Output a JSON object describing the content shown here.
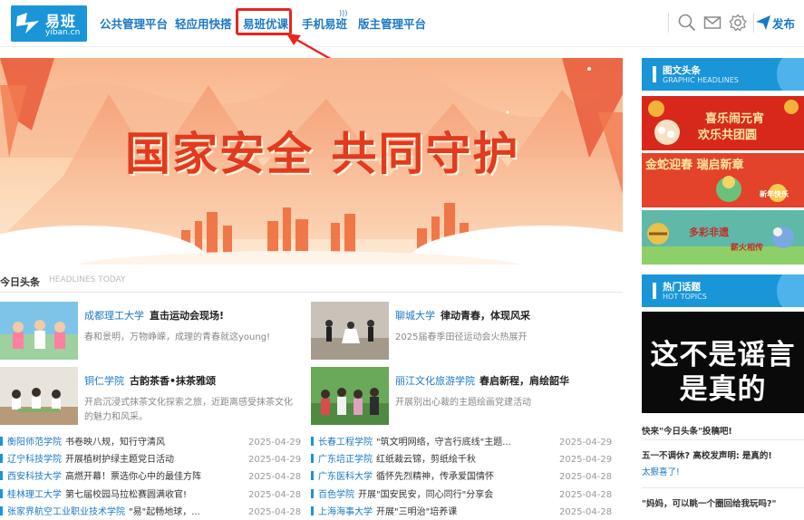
{
  "header": {
    "logo_name": "易班",
    "logo_url": "yiban.cn",
    "nav": [
      {
        "label": "公共管理平台"
      },
      {
        "label": "轻应用快搭"
      },
      {
        "label": "易班优课"
      },
      {
        "label": "手机易班"
      },
      {
        "label": "版主管理平台"
      }
    ],
    "highlighted_nav": "易班优课",
    "publish_label": "发布",
    "icons": [
      "search-icon",
      "mail-icon",
      "settings-icon",
      "send-icon"
    ]
  },
  "banner": {
    "title": "国家安全  共同守护",
    "colors": {
      "sky_top": "#fbc9a2",
      "sky_mid": "#fde2c4",
      "text": "#e23a1e",
      "mountain": "#f7a27a"
    }
  },
  "headlines": {
    "title": "今日头条",
    "subtitle": "HEADLINES TODAY",
    "featured": [
      {
        "school": "成都理工大学",
        "title": "直击运动会现场!",
        "desc": "春和景明，万物峥嵘，成理的青春就这young!"
      },
      {
        "school": "聊城大学",
        "title": "律动青春，体现风采",
        "desc": "2025届春季田径运动会火热展开"
      },
      {
        "school": "铜仁学院",
        "title": "古韵茶香•抹茶雅颂",
        "desc": "开启沉浸式抹茶文化探索之旅，近距离感受抹茶文化的魅力和风采。"
      },
      {
        "school": "丽江文化旅游学院",
        "title": "春启新程，肩绘韶华",
        "desc": "开展别出心裁的主题绘画党建活动"
      }
    ],
    "list_left": [
      {
        "school": "衡阳师范学院",
        "text": "书卷映八规，知行守清风",
        "date": "2025-04-29"
      },
      {
        "school": "辽宁科技学院",
        "text": "开展植树护绿主题党日活动",
        "date": "2025-04-29"
      },
      {
        "school": "西安科技大学",
        "text": "高燃开幕！票选你心中的最佳方阵",
        "date": "2025-04-28"
      },
      {
        "school": "桂林理工大学",
        "text": "第七届校园马拉松赛圆满收官!",
        "date": "2025-04-28"
      },
      {
        "school": "张家界航空工业职业技术学院",
        "text": "\"易\"起畅地球，...",
        "date": "2025-04-28"
      }
    ],
    "list_right": [
      {
        "school": "长春工程学院",
        "text": "\"筑文明网络，守言行底线\"主题...",
        "date": "2025-04-29"
      },
      {
        "school": "广东培正学院",
        "text": "红纸裁云锦，剪纸绘千秋",
        "date": "2025-04-29"
      },
      {
        "school": "广东医科大学",
        "text": "循怀先烈精神，传承爱国情怀",
        "date": "2025-04-28"
      },
      {
        "school": "百色学院",
        "text": "开展\"国安民安，同心同行\"分享会",
        "date": "2025-04-28"
      },
      {
        "school": "上海海事大学",
        "text": "开展\"三明治\"培养课",
        "date": "2025-04-28"
      }
    ]
  },
  "sidebar": {
    "graphic": {
      "title": "图文头条",
      "subtitle": "GRAPHIC HEADLINES",
      "images": [
        {
          "caption_line1": "喜乐闹元宵",
          "caption_line2": "欢乐共团圆"
        },
        {
          "caption_line1": "金蛇迎春 瑞启新章",
          "caption_line2": "新年快乐"
        },
        {
          "caption_line1": "多彩非遗",
          "caption_line2": "薪火相传"
        }
      ]
    },
    "hot": {
      "title": "热门话题",
      "subtitle": "HOT TOPICS",
      "image_line1": "这不是谣言",
      "image_line2": "是真的",
      "items": [
        {
          "title": "快来\"今日头条\"投稿吧!",
          "link": ""
        },
        {
          "title": "五一不调休? 高校发声明: 是真的!",
          "link": "太狠喜了!"
        },
        {
          "title": "\"妈妈，可以眺一个圈回给我玩吗?\"",
          "link": ""
        }
      ]
    }
  }
}
